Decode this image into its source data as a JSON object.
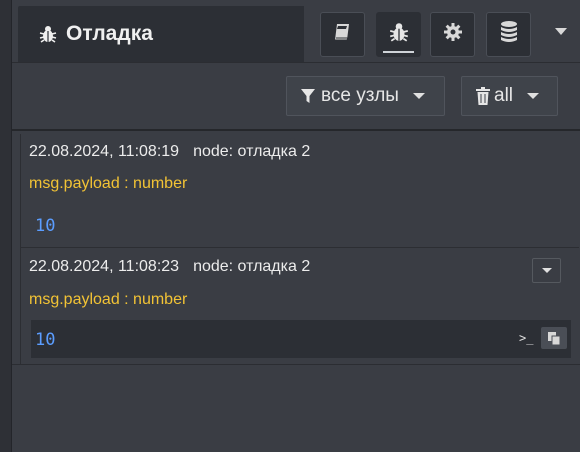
{
  "sidebar": {
    "title": "Отладка",
    "tabs": [
      {
        "name": "info",
        "icon": "book-icon"
      },
      {
        "name": "debug",
        "icon": "bug-icon",
        "active": true
      },
      {
        "name": "config",
        "icon": "gear-icon"
      },
      {
        "name": "context",
        "icon": "database-icon"
      }
    ]
  },
  "toolbar": {
    "filter_label": "все узлы",
    "clear_label": "all"
  },
  "messages": [
    {
      "timestamp": "22.08.2024, 11:08:19",
      "node": "node: отладка 2",
      "topic": "msg.payload : number",
      "value": "10"
    },
    {
      "timestamp": "22.08.2024, 11:08:23",
      "node": "node: отладка 2",
      "topic": "msg.payload : number",
      "value": "10"
    }
  ],
  "colors": {
    "topic": "#f2c335",
    "value": "#5b9dff",
    "panel": "#3a3d44",
    "dark": "#2c2f35"
  }
}
